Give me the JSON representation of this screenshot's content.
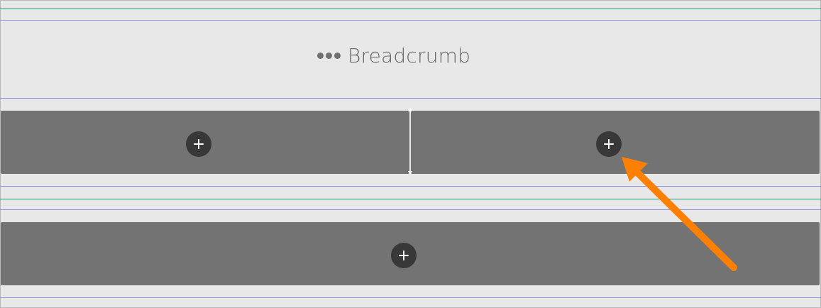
{
  "breadcrumb": {
    "label": "Breadcrumb",
    "icon": "more-horizontal-icon"
  },
  "sections": [
    {
      "name": "two-column-row",
      "columns": [
        {
          "add_button_icon": "plus-icon"
        },
        {
          "add_button_icon": "plus-icon"
        }
      ]
    },
    {
      "name": "single-column-row",
      "columns": [
        {
          "add_button_icon": "plus-icon"
        }
      ]
    }
  ],
  "annotation": {
    "arrow_color": "#FF8000",
    "target": "right-column-add-button"
  },
  "colors": {
    "canvas": "#E8E8E8",
    "block": "#737373",
    "button": "#383838",
    "guide_green": "#1E9B78",
    "guide_blue": "#8D8FE0"
  }
}
